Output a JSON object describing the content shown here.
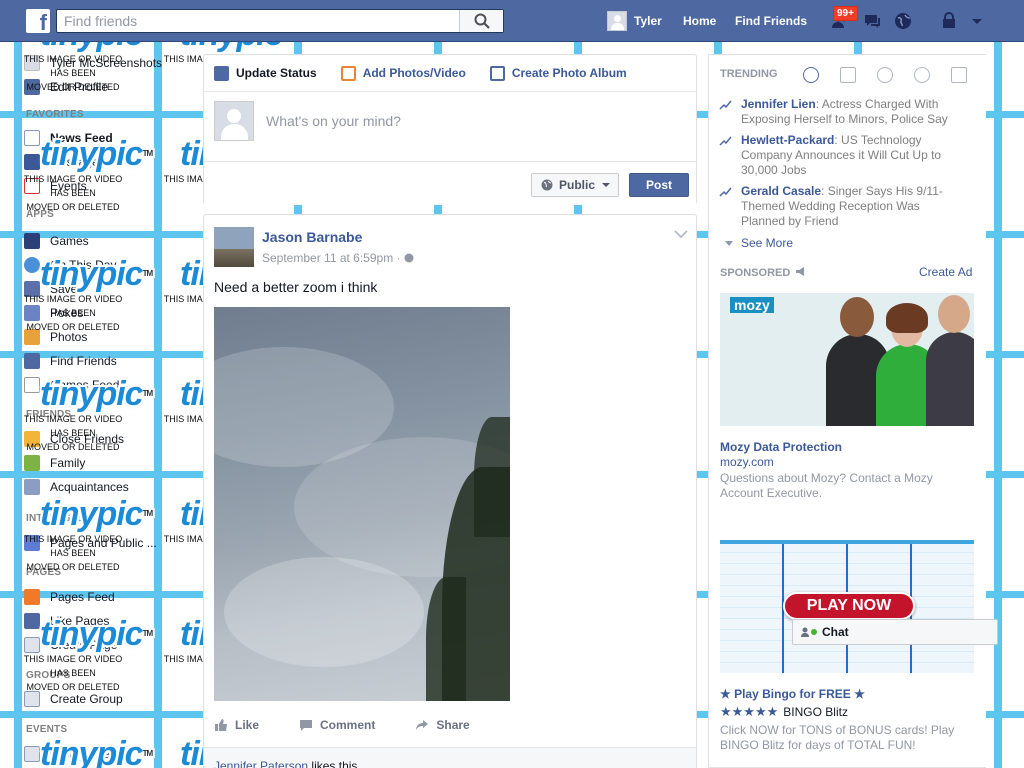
{
  "header": {
    "search_placeholder": "Find friends",
    "user_name": "Tyler",
    "nav_home": "Home",
    "nav_find_friends": "Find Friends",
    "notification_count": "99+"
  },
  "leftnav": {
    "profile_name": "Tyler McScreenshots",
    "edit_profile": "Edit Profile",
    "sections": {
      "favorites": "FAVORITES",
      "apps": "APPS",
      "friends": "FRIENDS",
      "interests": "INTERESTS",
      "pages": "PAGES",
      "groups": "GROUPS",
      "events": "EVENTS"
    },
    "items": {
      "news_feed": "News Feed",
      "messages": "Messages",
      "events": "Events",
      "games": "Games",
      "on_this_day": "On This Day",
      "saved": "Saved",
      "pokes": "Pokes",
      "photos": "Photos",
      "find_friends": "Find Friends",
      "games_feed": "Games Feed",
      "close_friends": "Close Friends",
      "family": "Family",
      "acquaintances": "Acquaintances",
      "pages_public": "Pages and Public ...",
      "pages_feed": "Pages Feed",
      "like_pages": "Like Pages",
      "create_page": "Create Page",
      "create_group": "Create Group",
      "create_event": "Create Event"
    }
  },
  "watermark": {
    "logo": "tinypic",
    "tm": "TM",
    "line1": "THIS IMAGE OR VIDEO",
    "line2": "HAS BEEN",
    "line3": "MOVED OR DELETED"
  },
  "composer": {
    "tab_status": "Update Status",
    "tab_photos": "Add Photos/Video",
    "tab_album": "Create Photo Album",
    "placeholder": "What's on your mind?",
    "privacy": "Public",
    "post": "Post"
  },
  "story": {
    "author": "Jason Barnabe",
    "time": "September 11 at 6:59pm · ",
    "text": "Need a better zoom i think",
    "like": "Like",
    "comment": "Comment",
    "share": "Share",
    "liker": "Jennifer Paterson",
    "likes_suffix": " likes this."
  },
  "trending": {
    "title": "TRENDING",
    "items": [
      {
        "name": "Jennifer Lien",
        "text": ": Actress Charged With Exposing Herself to Minors, Police Say"
      },
      {
        "name": "Hewlett-Packard",
        "text": ": US Technology Company Announces it Will Cut Up to 30,000 Jobs"
      },
      {
        "name": "Gerald Casale",
        "text": ": Singer Says His 9/11-Themed Wedding Reception Was Planned by Friend"
      }
    ],
    "see_more": "See More"
  },
  "sponsored": {
    "title": "SPONSORED",
    "create_ad": "Create Ad",
    "ad1": {
      "brand": "mozy",
      "title": "Mozy Data Protection",
      "url": "mozy.com",
      "body": "Questions about Mozy? Contact a Mozy Account Executive."
    },
    "ad2": {
      "play_now": "PLAY NOW",
      "title": "★ Play Bingo for FREE ★",
      "stars": "★★★★★",
      "brand": "BINGO Blitz",
      "body": "Click NOW for TONS of BONUS cards! Play BINGO Blitz for days of TOTAL FUN!"
    }
  },
  "chat": {
    "label": "Chat"
  },
  "colors": {
    "header_blue": "#4e69a2",
    "link_blue": "#3b5998",
    "watermark_cyan": "#5ec6ee",
    "notification_red": "#f03d25"
  }
}
